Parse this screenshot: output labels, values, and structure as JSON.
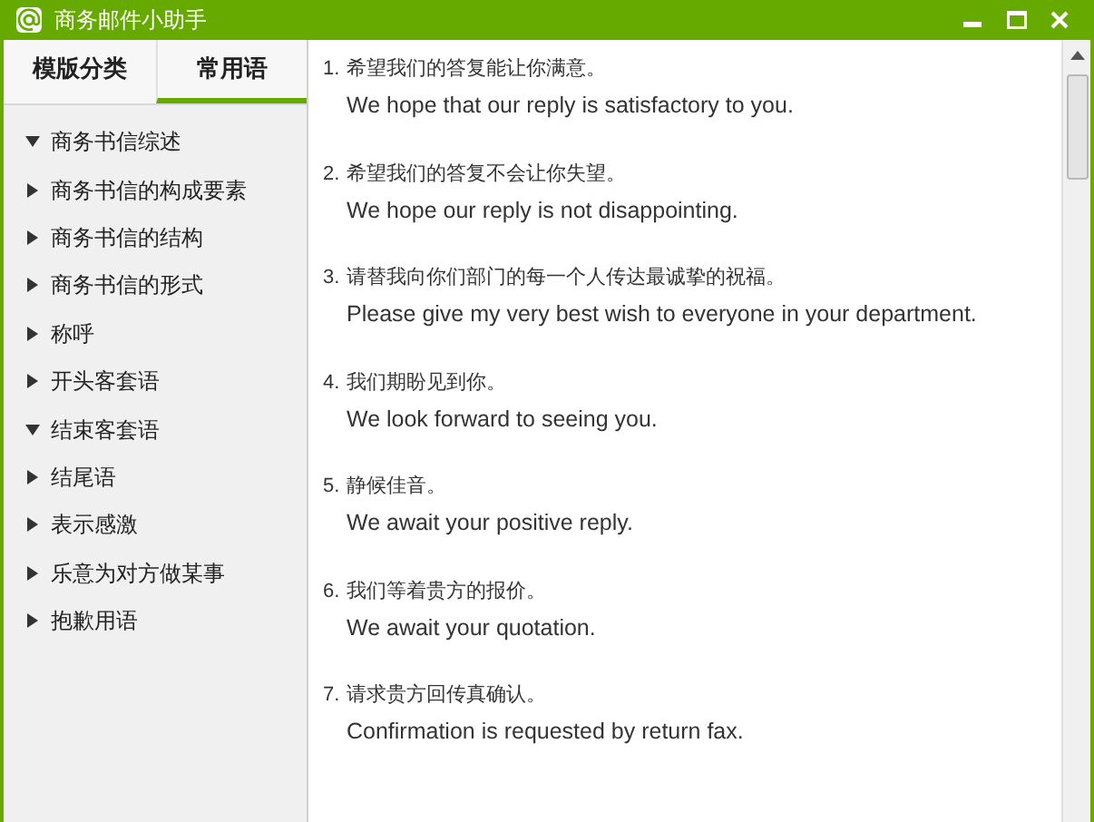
{
  "window": {
    "title": "商务邮件小助手"
  },
  "tabs": [
    {
      "label": "模版分类",
      "selected": false
    },
    {
      "label": "常用语",
      "selected": true
    }
  ],
  "tree": [
    {
      "label": "商务书信综述",
      "expanded": true
    },
    {
      "label": "商务书信的构成要素",
      "expanded": false
    },
    {
      "label": "商务书信的结构",
      "expanded": false
    },
    {
      "label": "商务书信的形式",
      "expanded": false
    },
    {
      "label": "称呼",
      "expanded": false
    },
    {
      "label": "开头客套语",
      "expanded": false
    },
    {
      "label": "结束客套语",
      "expanded": true
    },
    {
      "label": "结尾语",
      "expanded": false
    },
    {
      "label": "表示感激",
      "expanded": false
    },
    {
      "label": "乐意为对方做某事",
      "expanded": false
    },
    {
      "label": "抱歉用语",
      "expanded": false
    }
  ],
  "phrases": [
    {
      "number": "1.",
      "chinese": "希望我们的答复能让你满意。",
      "english": "We hope that our reply is satisfactory to you."
    },
    {
      "number": "2.",
      "chinese": "希望我们的答复不会让你失望。",
      "english": "We hope our reply is not disappointing."
    },
    {
      "number": "3.",
      "chinese": "请替我向你们部门的每一个人传达最诚挚的祝福。",
      "english": "Please give my very best wish to everyone in your department."
    },
    {
      "number": "4.",
      "chinese": "我们期盼见到你。",
      "english": "We look forward to seeing you."
    },
    {
      "number": "5.",
      "chinese": "静候佳音。",
      "english": "We await your positive reply."
    },
    {
      "number": "6.",
      "chinese": "我们等着贵方的报价。",
      "english": "We await your quotation."
    },
    {
      "number": "7.",
      "chinese": "请求贵方回传真确认。",
      "english": "Confirmation is requested by return fax."
    }
  ]
}
